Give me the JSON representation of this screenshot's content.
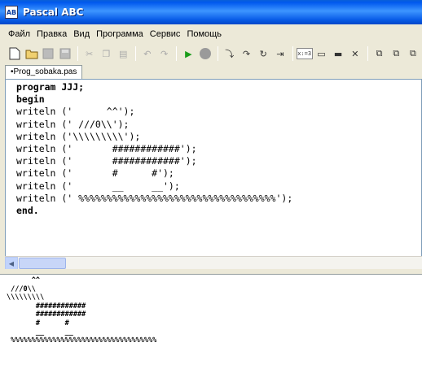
{
  "window": {
    "title": "Pascal ABC",
    "icon_label": "AB"
  },
  "menu": {
    "items": [
      {
        "label": "Файл"
      },
      {
        "label": "Правка"
      },
      {
        "label": "Вид"
      },
      {
        "label": "Программа"
      },
      {
        "label": "Сервис"
      },
      {
        "label": "Помощь"
      }
    ]
  },
  "toolbar": {
    "icons": [
      "new-file-icon",
      "open-folder-icon",
      "save-icon",
      "save-all-icon",
      "cut-icon",
      "copy-icon",
      "paste-icon",
      "undo-icon",
      "redo-icon",
      "run-icon",
      "stop-icon",
      "step-into-icon",
      "step-over-icon",
      "step-out-icon",
      "run-to-cursor-icon",
      "watch-icon",
      "window-icon",
      "breakpoint-icon",
      "delete-icon",
      "window-restore-icon",
      "window-tile-icon",
      "window-cascade-icon"
    ],
    "watch_label": "x:=3"
  },
  "tab": {
    "label": "•Prog_sobaka.pas"
  },
  "editor": {
    "lines": [
      "program JJJ;",
      "begin",
      "writeln ('      ^^');",
      "writeln (' ///0\\\\');",
      "writeln ('\\\\\\\\\\\\\\\\\\');",
      "writeln ('       ############');",
      "writeln ('       ############');",
      "writeln ('       #      #');",
      "writeln ('       __     __');",
      "writeln (' %%%%%%%%%%%%%%%%%%%%%%%%%%%%%%%%%%%');",
      "end."
    ]
  },
  "output": {
    "lines": [
      "      ^^",
      " ///0\\\\",
      "\\\\\\\\\\\\\\\\\\",
      "       ############",
      "       ############",
      "       #      #",
      "       __     __",
      " %%%%%%%%%%%%%%%%%%%%%%%%%%%%%%%%%%%"
    ]
  }
}
